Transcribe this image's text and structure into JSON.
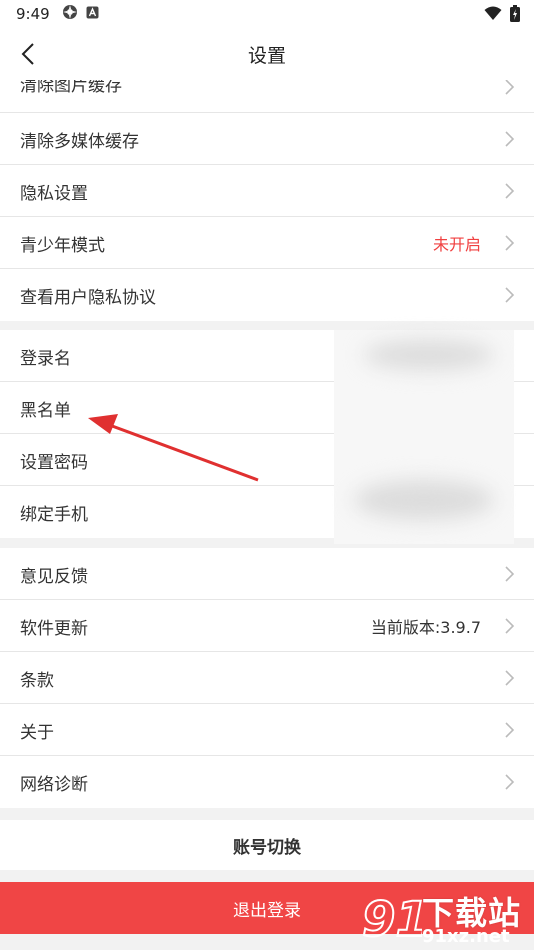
{
  "status_bar": {
    "time": "9:49"
  },
  "header": {
    "title": "设置"
  },
  "settings_group_1": {
    "partial_item": "清除图片缓存",
    "items": [
      {
        "label": "清除多媒体缓存",
        "value": ""
      },
      {
        "label": "隐私设置",
        "value": ""
      },
      {
        "label": "青少年模式",
        "value": "未开启"
      },
      {
        "label": "查看用户隐私协议",
        "value": ""
      }
    ]
  },
  "account_group": {
    "items": [
      {
        "label": "登录名"
      },
      {
        "label": "黑名单"
      },
      {
        "label": "设置密码"
      },
      {
        "label": "绑定手机"
      }
    ]
  },
  "settings_group_2": {
    "items": [
      {
        "label": "意见反馈",
        "value": ""
      },
      {
        "label": "软件更新",
        "value": "当前版本:3.9.7"
      },
      {
        "label": "条款",
        "value": ""
      },
      {
        "label": "关于",
        "value": ""
      },
      {
        "label": "网络诊断",
        "value": ""
      }
    ]
  },
  "buttons": {
    "switch_account": "账号切换",
    "logout": "退出登录"
  },
  "watermark": {
    "title": "下载站",
    "domain": "91xz.net"
  },
  "colors": {
    "accent_red": "#f04545",
    "warning_text": "#f04040"
  }
}
